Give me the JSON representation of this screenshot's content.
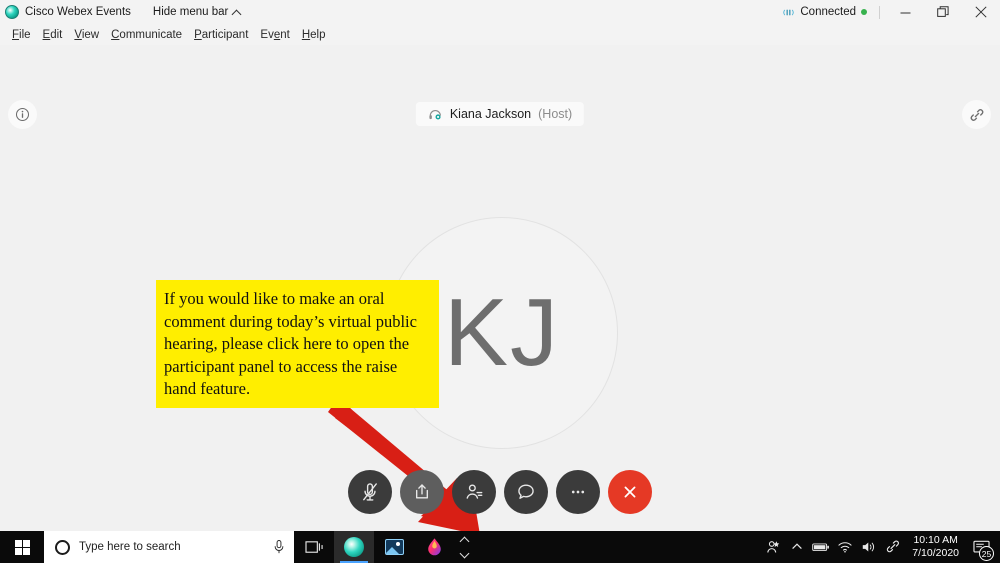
{
  "titlebar": {
    "logo_icon": "webex-logo-icon",
    "app_title": "Cisco Webex Events",
    "hide_menu_label": "Hide menu bar",
    "hide_menu_caret_icon": "chevron-up-icon",
    "connection_icon": "signal-icon",
    "connection_label": "Connected",
    "connection_dot_color": "#37b24d",
    "minimize_icon": "minimize-icon",
    "restore_icon": "restore-icon",
    "close_icon": "close-icon"
  },
  "menubar": {
    "items": [
      {
        "label": "File",
        "accel": "F"
      },
      {
        "label": "Edit",
        "accel": "E"
      },
      {
        "label": "View",
        "accel": "V"
      },
      {
        "label": "Communicate",
        "accel": "C"
      },
      {
        "label": "Participant",
        "accel": "P"
      },
      {
        "label": "Event",
        "accel": "E"
      },
      {
        "label": "Help",
        "accel": "H"
      }
    ]
  },
  "stage": {
    "background_color": "#f1f1f1",
    "info_button_icon": "info-circle-icon",
    "layout_button_icon": "link-icon",
    "host": {
      "audio_icon": "headset-icon",
      "name": "Kiana Jackson",
      "role": "(Host)"
    },
    "avatar": {
      "initials": "KJ",
      "text_color": "#6e6e6e"
    },
    "callout": {
      "background_color": "#ffee00",
      "text": "If you would like to make an oral comment during today’s virtual public hearing, please click here to open the participant panel to access the raise hand feature."
    },
    "arrow": {
      "color": "#d81f15",
      "points_to": "participants-button"
    }
  },
  "controls": {
    "buttons": [
      {
        "name": "mute-button",
        "icon": "microphone-muted-icon",
        "label": "Mute",
        "state": "muted",
        "color": "#3b3b3b"
      },
      {
        "name": "share-button",
        "icon": "share-screen-icon",
        "label": "Share content",
        "state": "normal",
        "color": "#5e5e5e"
      },
      {
        "name": "participants-button",
        "icon": "participants-icon",
        "label": "Participants",
        "state": "normal",
        "color": "#3b3b3b"
      },
      {
        "name": "chat-button",
        "icon": "chat-bubble-icon",
        "label": "Chat",
        "state": "normal",
        "color": "#3b3b3b"
      },
      {
        "name": "more-button",
        "icon": "more-options-icon",
        "label": "More options",
        "state": "normal",
        "color": "#3b3b3b"
      },
      {
        "name": "leave-button",
        "icon": "close-x-icon",
        "label": "Leave event",
        "state": "normal",
        "color": "#e53925"
      }
    ]
  },
  "taskbar": {
    "start_icon": "windows-start-icon",
    "search": {
      "search_icon": "search-circle-icon",
      "placeholder": "Type here to search",
      "mic_icon": "microphone-icon"
    },
    "taskview_icon": "task-view-icon",
    "apps": [
      {
        "name": "webex",
        "icon": "webex-app-icon",
        "active": true
      },
      {
        "name": "photos",
        "icon": "photos-app-icon",
        "active": false
      },
      {
        "name": "paint",
        "icon": "paint-app-icon",
        "active": false
      }
    ],
    "overflow_icon": "scroll-arrows-icon",
    "tray": {
      "icons": [
        "people-icon",
        "show-hidden-icons-chevron",
        "battery-icon",
        "wifi-icon",
        "volume-icon",
        "pen-icon"
      ],
      "time": "10:10 AM",
      "date": "7/10/2020",
      "notification_icon": "action-center-icon",
      "notification_count": "25"
    }
  }
}
